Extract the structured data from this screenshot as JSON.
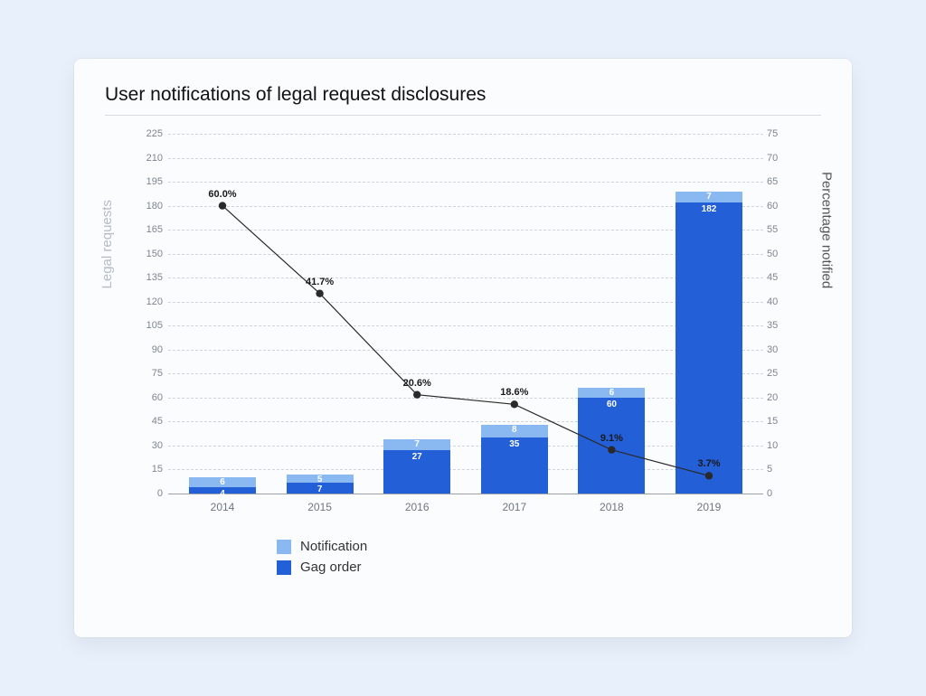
{
  "title": "User notifications of legal request disclosures",
  "axes": {
    "left_label": "Legal requests",
    "right_label": "Percentage notified",
    "left_ticks": [
      0,
      15,
      30,
      45,
      60,
      75,
      90,
      105,
      120,
      135,
      150,
      165,
      180,
      195,
      210,
      225
    ],
    "left_max": 225,
    "right_ticks": [
      0,
      5,
      10,
      15,
      20,
      25,
      30,
      35,
      40,
      45,
      50,
      55,
      60,
      65,
      70,
      75
    ],
    "right_max": 75
  },
  "legend": {
    "notification": "Notification",
    "gag_order": "Gag order"
  },
  "chart_data": {
    "type": "bar",
    "categories": [
      "2014",
      "2015",
      "2016",
      "2017",
      "2018",
      "2019"
    ],
    "series": [
      {
        "name": "Gag order",
        "values": [
          4,
          7,
          27,
          35,
          60,
          182
        ],
        "color": "#235fd6"
      },
      {
        "name": "Notification",
        "values": [
          6,
          5,
          7,
          8,
          6,
          7
        ],
        "color": "#89b9f0"
      },
      {
        "name": "Percentage notified",
        "values": [
          60.0,
          41.7,
          20.6,
          18.6,
          9.1,
          3.7
        ],
        "axis": "right",
        "type": "line"
      }
    ],
    "line_labels": [
      "60.0%",
      "41.7%",
      "20.6%",
      "18.6%",
      "9.1%",
      "3.7%"
    ],
    "ylabel_left": "Legal requests",
    "ylabel_right": "Percentage notified",
    "ylim_left": [
      0,
      225
    ],
    "ylim_right": [
      0,
      75
    ]
  }
}
